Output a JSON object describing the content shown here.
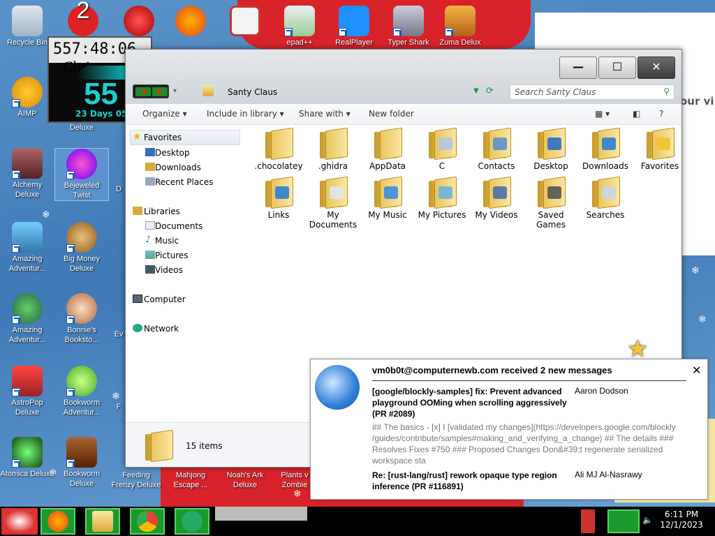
{
  "desktop": {
    "top_icons": [
      {
        "label": "Recycle Bin",
        "icon": "recycle-bin-icon"
      },
      {
        "label": "",
        "icon": "app-icon"
      },
      {
        "label": "",
        "icon": "app-icon"
      },
      {
        "label": "",
        "icon": "firefox-icon"
      },
      {
        "label": "",
        "icon": "torii-icon"
      },
      {
        "label": "epad++",
        "icon": "notepad-plus-icon"
      },
      {
        "label": "RealPlayer",
        "icon": "realplayer-icon"
      },
      {
        "label": "Typer Shark",
        "icon": "shark-icon"
      },
      {
        "label": "Zuma Delux",
        "icon": "zuma-icon"
      }
    ],
    "left_icons": [
      {
        "label": "AIMP",
        "icon": "aimp-icon"
      },
      {
        "label": "Alchemy Deluxe",
        "icon": "wizard-icon"
      },
      {
        "label": "Bejeweled Twist",
        "icon": "gem-icon"
      },
      {
        "label": "Amazing Adventur...",
        "icon": "adventure-icon"
      },
      {
        "label": "Big Money Deluxe",
        "icon": "money-bag-icon"
      },
      {
        "label": "Amazing Adventur...",
        "icon": "compass-icon"
      },
      {
        "label": "Bonnie's Booksto...",
        "icon": "bonnie-icon"
      },
      {
        "label": "AstroPop Deluxe",
        "icon": "astropop-icon"
      },
      {
        "label": "Bookworm Adventur...",
        "icon": "bookworm-icon"
      },
      {
        "label": "Atomica Deluxe",
        "icon": "atomica-icon"
      },
      {
        "label": "Bookworm Deluxe",
        "icon": "book-icon"
      }
    ],
    "partial_labels": [
      "Deluxe",
      "D",
      "Ev",
      "F"
    ],
    "bottom_icons": [
      "Feeding Frenzy Deluxe",
      "Mahjong Escape ...",
      "Noah's Ark Deluxe",
      "Plants v Zombie"
    ],
    "right_partial_text": "our vi"
  },
  "clock_widget": {
    "time": "557:48:06",
    "title": "Christm",
    "big_number": "55",
    "days": "23 Days 05"
  },
  "explorer": {
    "address": "Santy Claus",
    "search_placeholder": "Search Santy Claus",
    "toolbar": {
      "organize": "Organize",
      "include": "Include in library",
      "share": "Share with",
      "newfolder": "New folder"
    },
    "nav": {
      "favorites": "Favorites",
      "desktop": "Desktop",
      "downloads": "Downloads",
      "recent": "Recent Places",
      "libraries": "Libraries",
      "documents": "Documents",
      "music": "Music",
      "pictures": "Pictures",
      "videos": "Videos",
      "computer": "Computer",
      "network": "Network"
    },
    "files": [
      {
        "label": ".chocolatey",
        "emblem": "",
        "emblem_color": ""
      },
      {
        "label": ".ghidra",
        "emblem": "",
        "emblem_color": ""
      },
      {
        "label": "AppData",
        "emblem": "",
        "emblem_color": ""
      },
      {
        "label": "C",
        "emblem": "shortcut",
        "emblem_color": "#b0c6e0"
      },
      {
        "label": "Contacts",
        "emblem": "contacts",
        "emblem_color": "#5d8fcf"
      },
      {
        "label": "Desktop",
        "emblem": "desktop",
        "emblem_color": "#2f6fc0"
      },
      {
        "label": "Downloads",
        "emblem": "downloads",
        "emblem_color": "#2b7fd6"
      },
      {
        "label": "Favorites",
        "emblem": "star",
        "emblem_color": "#f1c232"
      },
      {
        "label": "Links",
        "emblem": "links",
        "emblem_color": "#2b7fd6"
      },
      {
        "label": "My Documents",
        "emblem": "documents",
        "emblem_color": "#dfe6ee"
      },
      {
        "label": "My Music",
        "emblem": "music",
        "emblem_color": "#3a8fd9"
      },
      {
        "label": "My Pictures",
        "emblem": "pictures",
        "emblem_color": "#6fb3e0"
      },
      {
        "label": "My Videos",
        "emblem": "videos",
        "emblem_color": "#4a6fa8"
      },
      {
        "label": "Saved Games",
        "emblem": "games",
        "emblem_color": "#555555"
      },
      {
        "label": "Searches",
        "emblem": "search",
        "emblem_color": "#c8d6e6"
      }
    ],
    "status": "15 items"
  },
  "notification": {
    "header": "vm0b0t@computernewb.com received 2 new messages",
    "messages": [
      {
        "subject": "[google/blockly-samples] fix: Prevent advanced playground OOMing when scrolling aggressively (PR #2089)",
        "from": "Aaron Dodson"
      },
      {
        "subject": "Re: [rust-lang/rust] rework opaque type region inference (PR #116891)",
        "from": "Ali MJ Al-Nasrawy"
      }
    ],
    "preview": "## The basics - [x] I [validated my changes](https://developers.google.com/blockly /guides/contribute/samples#making_and_verifying_a_change) ## The details ### Resolves Fixes #750 ### Proposed Changes Don&#39;t regenerate serialized workspace sta"
  },
  "taskbar": {
    "time": "6:11 PM",
    "date": "12/1/2023"
  }
}
